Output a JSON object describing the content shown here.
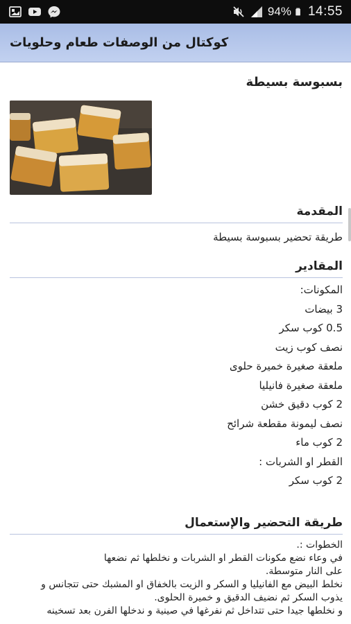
{
  "status_bar": {
    "battery_percent": "94%",
    "time": "14:55",
    "left_icons": [
      "gallery-icon",
      "youtube-icon",
      "messenger-icon"
    ],
    "right_icons": [
      "mute-icon",
      "signal-icon",
      "battery-icon"
    ]
  },
  "app_bar": {
    "title": "كوكتال من الوصفات طعام وحلويات"
  },
  "recipe": {
    "title": "بسبوسة بسيطة",
    "intro_heading": "المقدمة",
    "intro_text": "طريقة تحضير بسبوسة بسيطة",
    "ingredients_heading": "المقادير",
    "ingredients": [
      "المكونات:",
      "3 بيضات",
      "0.5 كوب سكر",
      "نصف كوب زيت",
      "ملعقة صغيرة خميرة حلوى",
      "ملعقة صغيرة فانيليا",
      "2 كوب دقيق خشن",
      "نصف ليمونة مقطعة شرائح",
      "2 كوب ماء",
      "القطر او الشربات :",
      "2 كوب سكر"
    ],
    "method_heading": "طريقة التحضير والإستعمال",
    "steps": [
      "الخطوات :.",
      "في وعاء نضع مكونات القطر او الشربات و نخلطها ثم نضعها",
      "على النار متوسطة.",
      "نخلط البيض مع الفانيليا و السكر و الزيت بالخفاق او المشبك حتى تتجانس و",
      "يذوب السكر ثم نضيف الدقيق و خميرة الحلوى.",
      "و نخلطها جيدا حتى تتداخل ثم نفرغها في صينية و ندخلها الفرن بعد تسخينه"
    ]
  },
  "colors": {
    "app_bar_top": "#a9bde6",
    "app_bar_bottom": "#c2d1f0",
    "divider": "#b8c3de",
    "status_bar": "#0d0d0d"
  }
}
